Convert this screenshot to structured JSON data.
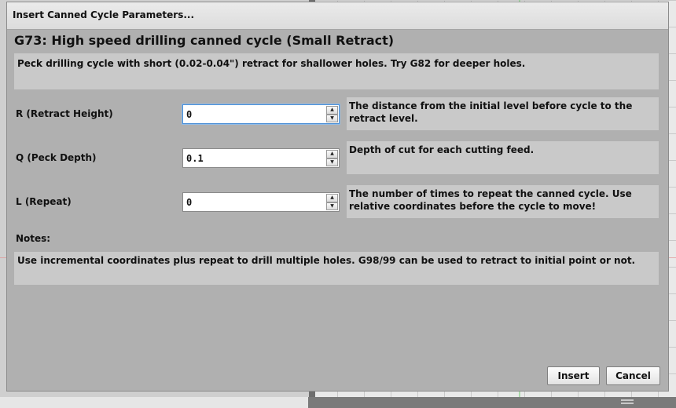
{
  "dialog": {
    "title": "Insert Canned Cycle Parameters...",
    "heading": "G73: High speed drilling canned cycle (Small Retract)",
    "description": "Peck drilling cycle with short (0.02-0.04\") retract for shallower holes.  Try G82 for deeper holes.",
    "params": [
      {
        "label": "R (Retract Height)",
        "value": "0",
        "help": "The distance from the initial level before cycle to the retract level."
      },
      {
        "label": "Q (Peck Depth)",
        "value": "0.1",
        "help": "Depth of cut for each cutting feed."
      },
      {
        "label": "L (Repeat)",
        "value": "0",
        "help": "The number of times to repeat the canned cycle. Use relative coordinates before the cycle to move!"
      }
    ],
    "notes_label": "Notes:",
    "notes": "Use incremental coordinates plus repeat to drill multiple holes.  G98/99 can be used to retract to initial point or not.",
    "insert_label": "Insert",
    "cancel_label": "Cancel"
  },
  "icons": {
    "spin_up": "arrow-up-icon",
    "spin_down": "arrow-down-icon"
  }
}
